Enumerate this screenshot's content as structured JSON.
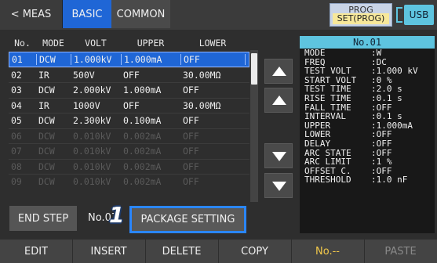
{
  "topbar": {
    "tabs": [
      "< MEAS",
      "BASIC",
      "COMMON"
    ],
    "prog_label": "PROG",
    "prog_value": "SET(PROG)",
    "usb_label": "USB"
  },
  "table": {
    "headers": [
      "No.",
      "MODE",
      "VOLT",
      "UPPER",
      "LOWER"
    ],
    "rows": [
      [
        "01",
        "DCW",
        "1.000kV",
        "1.000mA",
        "OFF"
      ],
      [
        "02",
        "IR",
        "500V",
        "OFF",
        "30.00MΩ"
      ],
      [
        "03",
        "DCW",
        "2.000kV",
        "1.000mA",
        "OFF"
      ],
      [
        "04",
        "IR",
        "1000V",
        "OFF",
        "30.00MΩ"
      ],
      [
        "05",
        "DCW",
        "2.300kV",
        "0.100mA",
        "OFF"
      ],
      [
        "06",
        "DCW",
        "0.010kV",
        "0.002mA",
        "OFF"
      ],
      [
        "07",
        "DCW",
        "0.010kV",
        "0.002mA",
        "OFF"
      ],
      [
        "08",
        "DCW",
        "0.010kV",
        "0.002mA",
        "OFF"
      ],
      [
        "09",
        "DCW",
        "0.010kV",
        "0.002mA",
        "OFF"
      ]
    ],
    "selected_index": 0,
    "active_count": 5
  },
  "detail": {
    "title": "No.01",
    "rows": [
      [
        "MODE",
        ":W"
      ],
      [
        "FREQ",
        ":DC"
      ],
      [
        "TEST VOLT",
        ":1.000 kV"
      ],
      [
        "START VOLT",
        ":0 %"
      ],
      [
        "TEST TIME",
        ":2.0 s"
      ],
      [
        "RISE TIME",
        ":0.1 s"
      ],
      [
        "FALL TIME",
        ":OFF"
      ],
      [
        "INTERVAL",
        ":0.1 s"
      ],
      [
        "UPPER",
        ":1.000mA"
      ],
      [
        "LOWER",
        ":OFF"
      ],
      [
        "DELAY",
        ":OFF"
      ],
      [
        "ARC STATE",
        ":OFF"
      ],
      [
        "ARC LIMIT",
        ":1 %"
      ],
      [
        "OFFSET C.",
        ":OFF"
      ],
      [
        "THRESHOLD",
        ":1.0 nF"
      ]
    ]
  },
  "actions": {
    "end_step": "END STEP",
    "no_label": "No.07",
    "package_setting": "PACKAGE SETTING",
    "callout": "1"
  },
  "softkeys": [
    "EDIT",
    "INSERT",
    "DELETE",
    "COPY",
    "No.--",
    "PASTE"
  ],
  "colors": {
    "accent": "#1f66d6",
    "highlight_border": "#2a86ff",
    "cyan": "#5ec4df"
  }
}
